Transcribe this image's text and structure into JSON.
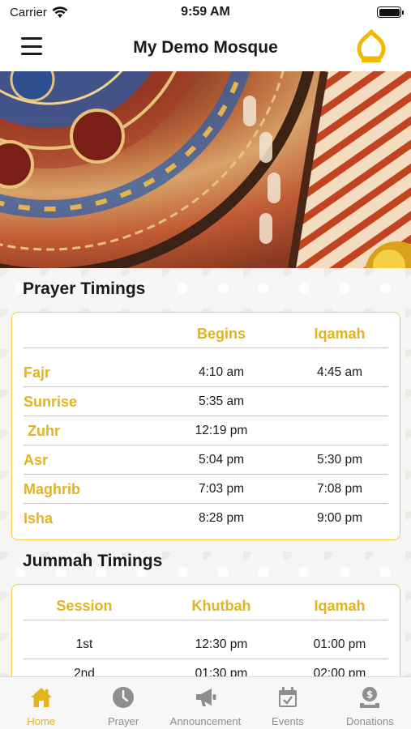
{
  "status_bar": {
    "carrier": "Carrier",
    "time": "9:59 AM"
  },
  "nav": {
    "title": "My Demo Mosque"
  },
  "prayer": {
    "title": "Prayer Timings",
    "headers": {
      "begins": "Begins",
      "iqamah": "Iqamah"
    },
    "rows": [
      {
        "name": "Fajr",
        "begins": "4:10 am",
        "iqamah": "4:45 am"
      },
      {
        "name": "Sunrise",
        "begins": "5:35 am",
        "iqamah": ""
      },
      {
        "name": " Zuhr",
        "begins": "12:19 pm",
        "iqamah": ""
      },
      {
        "name": "Asr",
        "begins": "5:04 pm",
        "iqamah": "5:30 pm"
      },
      {
        "name": "Maghrib",
        "begins": "7:03 pm",
        "iqamah": "7:08 pm"
      },
      {
        "name": "Isha",
        "begins": "8:28 pm",
        "iqamah": "9:00 pm"
      }
    ]
  },
  "jummah": {
    "title": "Jummah Timings",
    "headers": {
      "session": "Session",
      "khutbah": "Khutbah",
      "iqamah": "Iqamah"
    },
    "rows": [
      {
        "session": "1st",
        "khutbah": "12:30 pm",
        "iqamah": "01:00 pm"
      },
      {
        "session": "2nd",
        "khutbah": "01:30 pm",
        "iqamah": "02:00 pm"
      }
    ]
  },
  "tabs": [
    {
      "label": "Home",
      "icon": "home-icon",
      "active": true
    },
    {
      "label": "Prayer",
      "icon": "clock-icon",
      "active": false
    },
    {
      "label": "Announcement",
      "icon": "megaphone-icon",
      "active": false
    },
    {
      "label": "Events",
      "icon": "calendar-icon",
      "active": false
    },
    {
      "label": "Donations",
      "icon": "donation-icon",
      "active": false
    }
  ],
  "colors": {
    "accent": "#e4b320",
    "inactive": "#8e8e8e"
  }
}
